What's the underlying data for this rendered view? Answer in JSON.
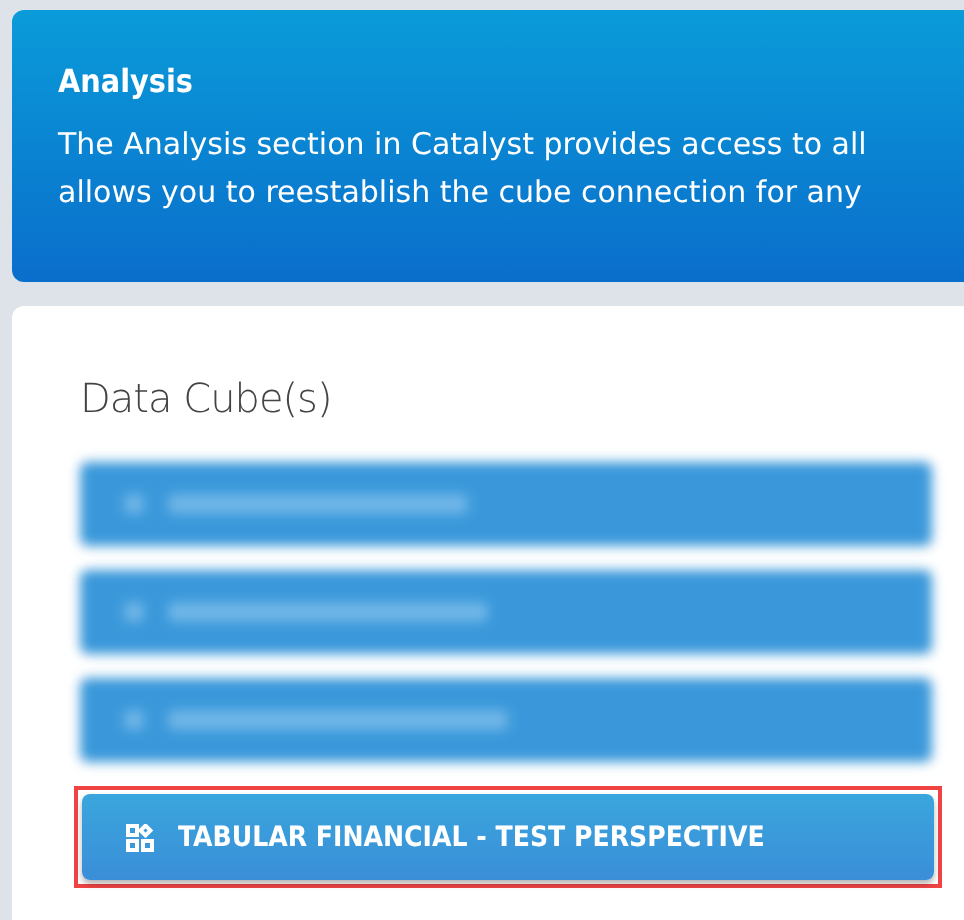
{
  "header": {
    "title": "Analysis",
    "lines": [
      "The Analysis section in Catalyst provides access to all",
      "allows you to reestablish the cube connection for any"
    ]
  },
  "panel": {
    "title": "Data Cube(s)"
  },
  "cubes": [
    {
      "kind": "blurred"
    },
    {
      "kind": "blurred"
    },
    {
      "kind": "blurred"
    },
    {
      "kind": "button",
      "label": "TABULAR FINANCIAL - TEST PERSPECTIVE",
      "highlighted": true
    }
  ]
}
